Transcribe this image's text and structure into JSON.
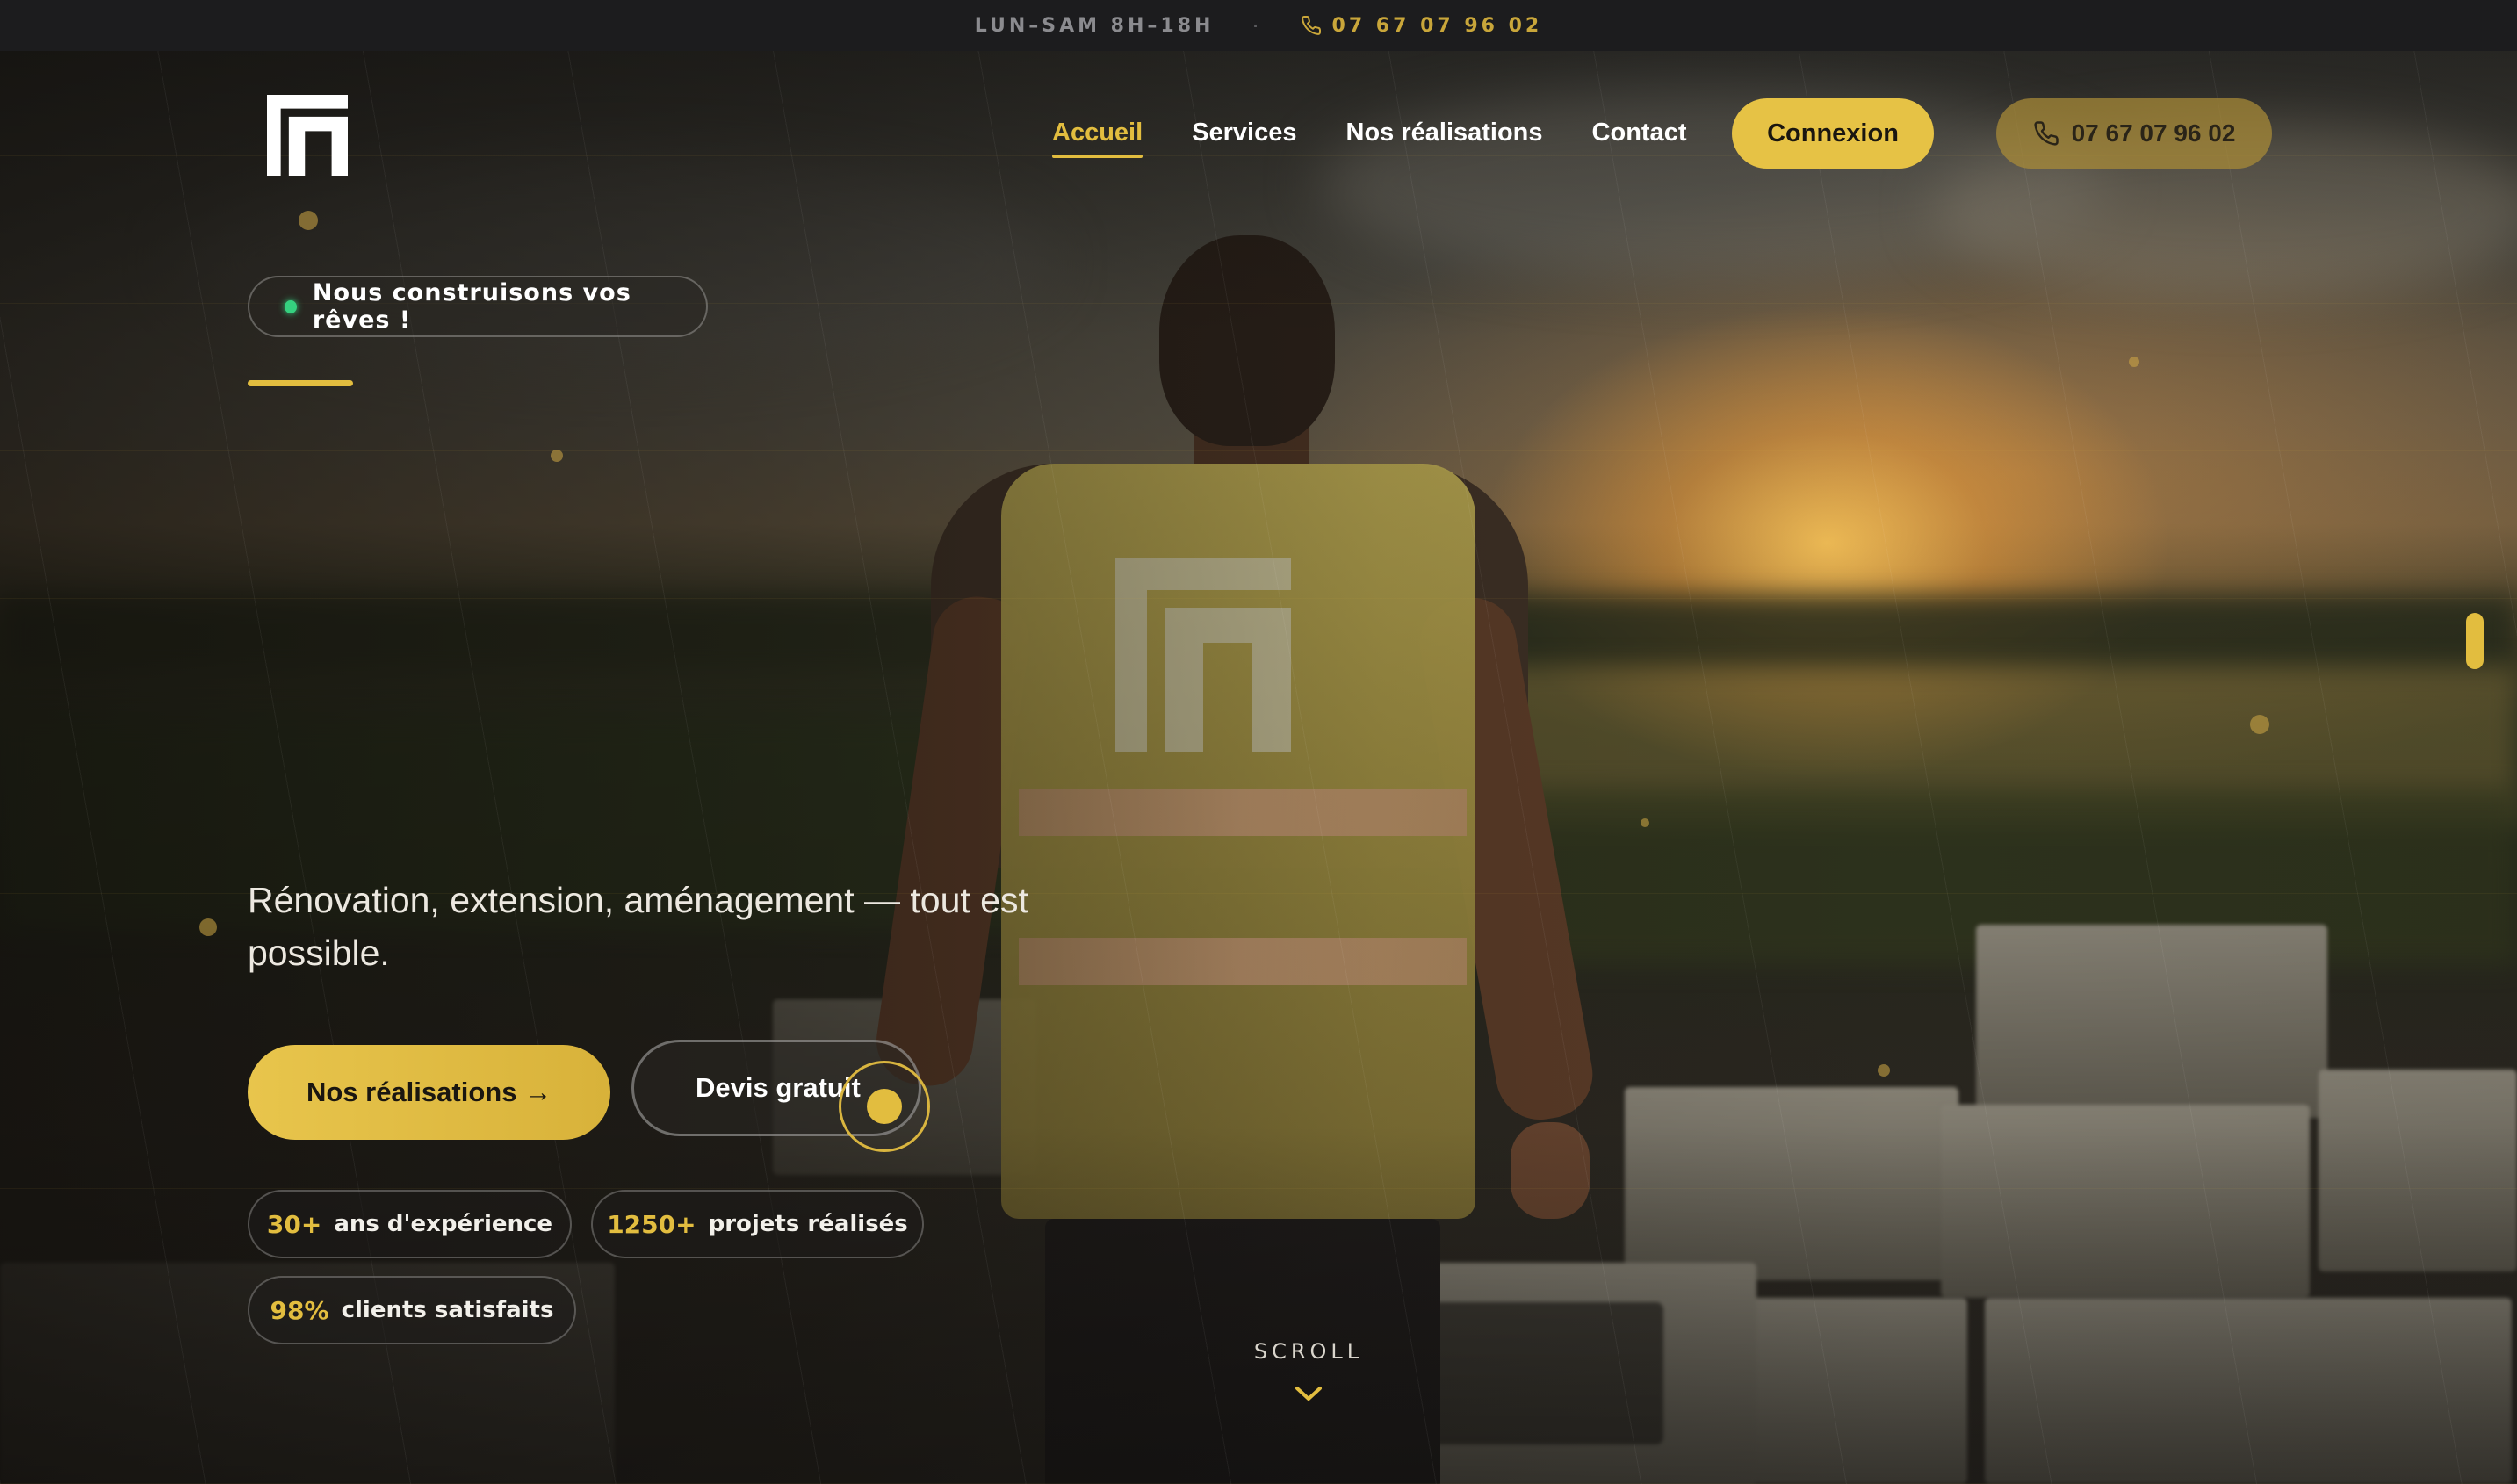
{
  "topbar": {
    "hours": "LUN–SAM 8H–18H",
    "separator": "·",
    "phone": "07 67 07 96 02"
  },
  "nav": {
    "items": [
      {
        "label": "Accueil",
        "active": true
      },
      {
        "label": "Services",
        "active": false
      },
      {
        "label": "Nos réalisations",
        "active": false
      },
      {
        "label": "Contact",
        "active": false
      }
    ],
    "login": "Connexion",
    "phone": "07 67 07 96 02"
  },
  "hero": {
    "badge": "Nous construisons vos rêves !",
    "subtitle": "Rénovation, extension, aménagement — tout est possible.",
    "cta_primary": "Nos réalisations →",
    "cta_secondary": "Devis gratuit",
    "stats": [
      {
        "value": "30+",
        "label": "ans d'expérience"
      },
      {
        "value": "1250+",
        "label": "projets réalisés"
      },
      {
        "value": "98%",
        "label": "clients satisfaits"
      }
    ],
    "scroll": "SCROLL"
  },
  "colors": {
    "accent": "#e2bd3f",
    "topbar_bg": "#1c1c1e",
    "status_green": "#35d07f"
  },
  "icons": [
    "phone-icon",
    "logo-mark",
    "chevron-down-icon"
  ]
}
